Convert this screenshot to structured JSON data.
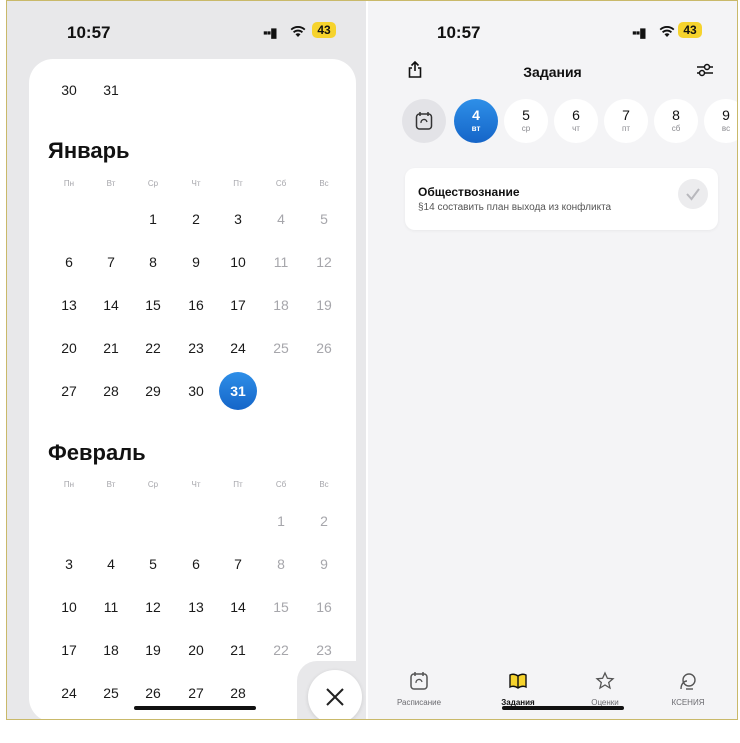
{
  "left_screen": {
    "status": {
      "time": "10:57",
      "battery": "43"
    },
    "top_row": [
      "30",
      "31"
    ],
    "weekdays": [
      "Пн",
      "Вт",
      "Ср",
      "Чт",
      "Пт",
      "Сб",
      "Вс"
    ],
    "january": {
      "title": "Январь",
      "weeks": [
        [
          "",
          "",
          "1",
          "2",
          "3",
          "4",
          "5"
        ],
        [
          "6",
          "7",
          "8",
          "9",
          "10",
          "11",
          "12"
        ],
        [
          "13",
          "14",
          "15",
          "16",
          "17",
          "18",
          "19"
        ],
        [
          "20",
          "21",
          "22",
          "23",
          "24",
          "25",
          "26"
        ],
        [
          "27",
          "28",
          "29",
          "30",
          "31",
          "",
          ""
        ]
      ],
      "selected": "31"
    },
    "february": {
      "title": "Февраль",
      "weeks": [
        [
          "",
          "",
          "",
          "",
          "",
          "1",
          "2"
        ],
        [
          "3",
          "4",
          "5",
          "6",
          "7",
          "8",
          "9"
        ],
        [
          "10",
          "11",
          "12",
          "13",
          "14",
          "15",
          "16"
        ],
        [
          "17",
          "18",
          "19",
          "20",
          "21",
          "22",
          "23"
        ],
        [
          "24",
          "25",
          "26",
          "27",
          "28",
          "",
          ""
        ]
      ]
    },
    "close_icon": "close-icon"
  },
  "right_screen": {
    "status": {
      "time": "10:57",
      "battery": "43"
    },
    "header": {
      "title": "Задания",
      "share_icon": "share-icon",
      "filter_icon": "filter-icon"
    },
    "days": [
      {
        "num": "4",
        "wd": "вт",
        "active": true
      },
      {
        "num": "5",
        "wd": "ср"
      },
      {
        "num": "6",
        "wd": "чт"
      },
      {
        "num": "7",
        "wd": "пт"
      },
      {
        "num": "8",
        "wd": "сб"
      },
      {
        "num": "9",
        "wd": "вс"
      }
    ],
    "task": {
      "subject": "Обществознание",
      "text": "§14 составить план выхода из конфликта"
    },
    "tabs": [
      {
        "label": "Расписание",
        "icon": "schedule-icon"
      },
      {
        "label": "Задания",
        "icon": "book-icon",
        "active": true
      },
      {
        "label": "Оценки",
        "icon": "star-icon"
      },
      {
        "label": "КСЕНИЯ",
        "icon": "profile-icon"
      }
    ]
  },
  "colors": {
    "accent": "#1e7ad8",
    "weekend": "#a6a6ab",
    "battery": "#f6d32d"
  }
}
